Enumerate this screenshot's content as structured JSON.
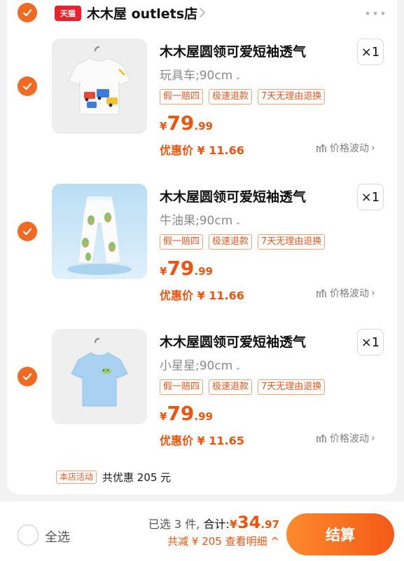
{
  "store": {
    "logo_text": "天猫",
    "name": "木木屋 outlets店"
  },
  "items": [
    {
      "title": "木木屋圆领可爱短袖透气",
      "sku": "玩具车;90cm",
      "qty": "×1",
      "tags": [
        "假一赔四",
        "极速退款",
        "7天无理由退换"
      ],
      "price_currency": "¥",
      "price_int": "79",
      "price_dec": ".99",
      "deal": "优惠价 ¥ 11.66",
      "trend": "价格波动",
      "image": "white-tshirt-with-toy-cars"
    },
    {
      "title": "木木屋圆领可爱短袖透气",
      "sku": "牛油果;90cm",
      "qty": "×1",
      "tags": [
        "假一赔四",
        "极速退款",
        "7天无理由退换"
      ],
      "price_currency": "¥",
      "price_int": "79",
      "price_dec": ".99",
      "deal": "优惠价 ¥ 11.66",
      "trend": "价格波动",
      "image": "avocado-print-pants"
    },
    {
      "title": "木木屋圆领可爱短袖透气",
      "sku": "小星星;90cm",
      "qty": "×1",
      "tags": [
        "假一赔四",
        "极速退款",
        "7天无理由退换"
      ],
      "price_currency": "¥",
      "price_int": "79",
      "price_dec": ".99",
      "deal": "优惠价 ¥ 11.65",
      "trend": "价格波动",
      "image": "light-blue-tshirt"
    }
  ],
  "promo": {
    "tag": "本店活动",
    "text": "共优惠 205 元"
  },
  "bottom": {
    "select_all": "全选",
    "selected": "已选 3 件,",
    "total_label": "合计:",
    "total_currency": "¥",
    "total_int": "34",
    "total_dec": ".97",
    "saving": "共减 ¥ 205  查看明细",
    "saving_caret": "^",
    "checkout": "结算"
  },
  "colors": {
    "accent": "#f16a22",
    "price": "#f2530c",
    "tmall_red": "#e8232c"
  },
  "icons": [
    "check-icon",
    "chevron-right-icon",
    "more-dots-icon",
    "chevron-down-icon",
    "price-trend-icon"
  ]
}
